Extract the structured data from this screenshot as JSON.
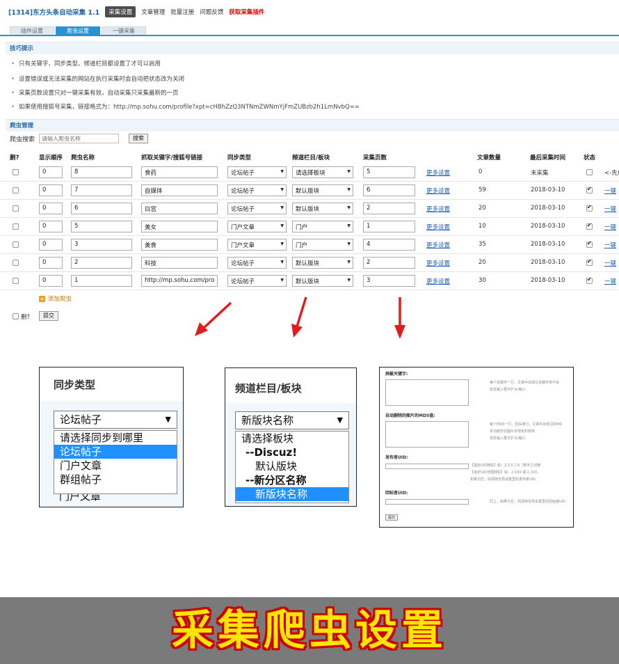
{
  "nav": {
    "app_name": "[1314]东方头条自动采集 1.1",
    "items": [
      {
        "label": "采集设置",
        "active": true,
        "red": false
      },
      {
        "label": "文章管理",
        "active": false,
        "red": false
      },
      {
        "label": "批量注册",
        "active": false,
        "red": false
      },
      {
        "label": "问题反馈",
        "active": false,
        "red": false
      },
      {
        "label": "获取采集插件",
        "active": false,
        "red": true
      }
    ]
  },
  "tabs": [
    {
      "label": "插件设置",
      "active": false
    },
    {
      "label": "爬虫设置",
      "active": true
    },
    {
      "label": "一键采集",
      "active": false
    }
  ],
  "tips": {
    "title": "技巧提示",
    "items": [
      "只有关键字、同步类型、频道栏目都设置了才可以启用",
      "设置错误或无法采集的网站在执行采集时会自动把状态改为关闭",
      "采集页数设置只对一键采集有效，自动采集只采集最新的一页",
      "如果使用搜狐号采集，链接格式为：http://mp.sohu.com/profile?xpt=cHBhZzQ3NTNmZWNmYjFmZUBzb2h1LmNvbQ=="
    ]
  },
  "crawler": {
    "title": "爬虫管理",
    "search_label": "爬虫搜索",
    "search_placeholder": "请输入爬虫名称",
    "search_button": "搜索",
    "headers": {
      "delete": "删?",
      "order": "显示顺序",
      "name": "爬虫名称",
      "keyword": "抓取关键字/搜狐号链接",
      "sync": "同步类型",
      "channel": "频道栏目/板块",
      "pages": "采集页数",
      "count": "文章数量",
      "last": "最后采集时间",
      "status": "状态"
    },
    "more_label": "更多设置",
    "rows": [
      {
        "order": "0",
        "name": "8",
        "keyword": "食药",
        "sync": "论坛帖子",
        "channel": "请选择板块",
        "pages": "5",
        "count": "0",
        "last": "未采集",
        "enabled": false,
        "action": "<-先启"
      },
      {
        "order": "0",
        "name": "7",
        "keyword": "自媒体",
        "sync": "论坛帖子",
        "channel": "默认版块",
        "pages": "6",
        "count": "59",
        "last": "2018-03-10",
        "enabled": true,
        "action": "一键"
      },
      {
        "order": "0",
        "name": "6",
        "keyword": "白宫",
        "sync": "论坛帖子",
        "channel": "默认版块",
        "pages": "2",
        "count": "20",
        "last": "2018-03-10",
        "enabled": true,
        "action": "一键"
      },
      {
        "order": "0",
        "name": "5",
        "keyword": "美女",
        "sync": "门户文章",
        "channel": "门户",
        "pages": "1",
        "count": "10",
        "last": "2018-03-10",
        "enabled": true,
        "action": "一键"
      },
      {
        "order": "0",
        "name": "3",
        "keyword": "美食",
        "sync": "门户文章",
        "channel": "门户",
        "pages": "4",
        "count": "35",
        "last": "2018-03-10",
        "enabled": true,
        "action": "一键"
      },
      {
        "order": "0",
        "name": "2",
        "keyword": "科技",
        "sync": "论坛帖子",
        "channel": "默认版块",
        "pages": "2",
        "count": "20",
        "last": "2018-03-10",
        "enabled": true,
        "action": "一键"
      },
      {
        "order": "0",
        "name": "1",
        "keyword": "http://mp.sohu.com/pro",
        "sync": "论坛帖子",
        "channel": "默认版块",
        "pages": "3",
        "count": "30",
        "last": "2018-03-10",
        "enabled": true,
        "action": "一键"
      }
    ],
    "add_label": "添加爬虫",
    "footer_delete": "删?",
    "submit": "提交"
  },
  "zoom_sync": {
    "title": "同步类型",
    "selected": "论坛帖子",
    "options": [
      "请选择同步到哪里",
      "论坛帖子",
      "门户文章",
      "群组帖子"
    ],
    "highlighted": 1,
    "clipped": "门户文章"
  },
  "zoom_channel": {
    "title": "频道栏目/板块",
    "selected": "新版块名称",
    "options": [
      {
        "label": "请选择板块",
        "bold": false,
        "indent": 0
      },
      {
        "label": "--Discuz!",
        "bold": true,
        "indent": 1
      },
      {
        "label": "默认版块",
        "bold": false,
        "indent": 2
      },
      {
        "label": "--新分区名称",
        "bold": true,
        "indent": 1
      },
      {
        "label": "新版块名称",
        "bold": false,
        "indent": 2
      }
    ],
    "highlighted": 4
  },
  "zoom_more": {
    "block_label": "屏蔽关键字:",
    "block_help": [
      "每个关键字一行，文章中出现过关键字将不会",
      "双击输入框可扩大/缩小"
    ],
    "md5_label": "自动删除的图片的MD5值:",
    "md5_help": [
      "每个MD5一行，回车换行，文章中出现过的MD",
      "本功能仅在图片本地化时有效",
      "双击输入框可扩大/缩小"
    ],
    "poster_label": "发布者UID:",
    "poster_help": [
      "【指定UID随机】如：2,3,5,7,6（数字之间使",
      "【指定UID范围随机】如：2-100 或 2,100，",
      "如果为空，则调用全局设置里的发布者UID"
    ],
    "reply_label": "回帖者UID:",
    "reply_help": [
      "同上，如果为空，则调用全局设置里的回帖者UID"
    ],
    "submit": "提交"
  },
  "banner": {
    "text": "采集爬虫设置"
  },
  "colors": {
    "accent": "#2b91d3",
    "link": "#1a5fb4",
    "arrow": "#e21c1c",
    "banner_bg": "#7a7a7a",
    "banner_text": "#ffe600",
    "banner_outline": "#cc0000"
  }
}
